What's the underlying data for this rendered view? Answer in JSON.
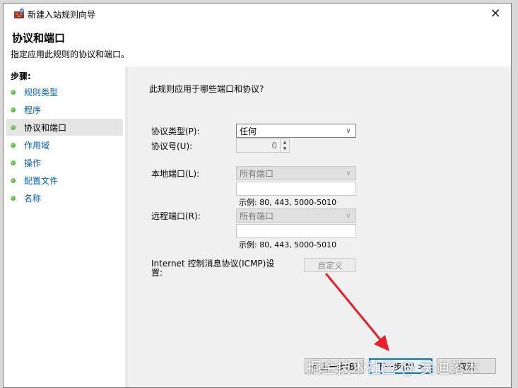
{
  "window": {
    "title": "新建入站规则向导",
    "close_label": "✕"
  },
  "header": {
    "title": "协议和端口",
    "subtitle": "指定应用此规则的协议和端口。"
  },
  "steps": {
    "heading": "步骤:",
    "items": [
      {
        "label": "规则类型"
      },
      {
        "label": "程序"
      },
      {
        "label": "协议和端口",
        "active": true
      },
      {
        "label": "作用域"
      },
      {
        "label": "操作"
      },
      {
        "label": "配置文件"
      },
      {
        "label": "名称"
      }
    ]
  },
  "content": {
    "question": "此规则应用于哪些端口和协议?",
    "protocol_type": {
      "label": "协议类型(P):",
      "value": "任何"
    },
    "protocol_number": {
      "label": "协议号(U):",
      "value": "0"
    },
    "local_port": {
      "label": "本地端口(L):",
      "value": "所有端口",
      "example": "示例: 80, 443, 5000-5010"
    },
    "remote_port": {
      "label": "远程端口(R):",
      "value": "所有端口",
      "example": "示例: 80, 443, 5000-5010"
    },
    "icmp": {
      "label": "Internet 控制消息协议(ICMP)设置:",
      "button": "自定义"
    }
  },
  "footer": {
    "back_label": "< 上一步(B)",
    "next_label": "下一步(N) >",
    "cancel_label": "取消"
  },
  "watermark": "掘金技术社区 @ 吴迪落木",
  "colors": {
    "accent": "#0078d7",
    "annotation_arrow": "#e8202a",
    "step_link": "#0060c0"
  }
}
